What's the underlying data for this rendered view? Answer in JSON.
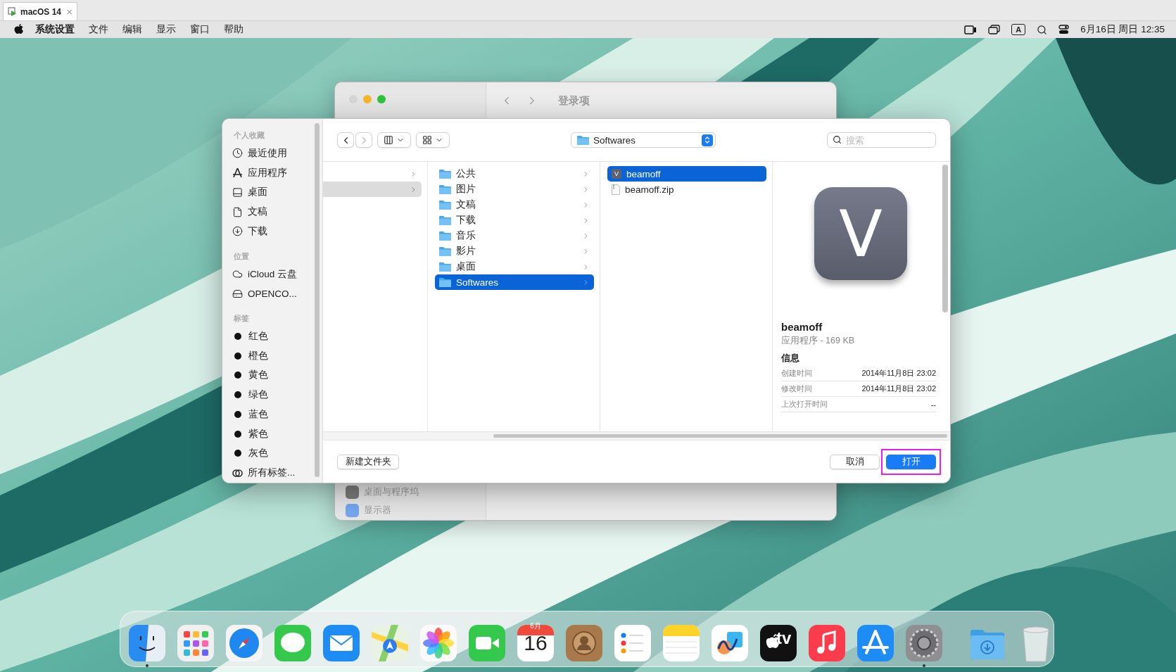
{
  "vm_tab": {
    "title": "macOS 14",
    "close": "×"
  },
  "menu_bar": {
    "app": "系统设置",
    "menus": [
      "文件",
      "编辑",
      "显示",
      "窗口",
      "帮助"
    ],
    "input_indicator": "A",
    "clock": "6月16日 周日 12:35"
  },
  "background_window": {
    "title": "登录项",
    "sidebar_items": [
      "桌面与程序坞",
      "显示器"
    ]
  },
  "dialog": {
    "sidebar": {
      "sections": [
        {
          "heading": "个人收藏",
          "items": [
            {
              "label": "最近使用",
              "kind": "recent"
            },
            {
              "label": "应用程序",
              "kind": "apps"
            },
            {
              "label": "桌面",
              "kind": "desktop"
            },
            {
              "label": "文稿",
              "kind": "documents"
            },
            {
              "label": "下载",
              "kind": "downloads"
            }
          ]
        },
        {
          "heading": "位置",
          "items": [
            {
              "label": "iCloud 云盘",
              "kind": "cloud"
            },
            {
              "label": "OPENCO...",
              "kind": "drive"
            }
          ]
        },
        {
          "heading": "标签",
          "items": [
            {
              "label": "红色",
              "kind": "tag"
            },
            {
              "label": "橙色",
              "kind": "tag"
            },
            {
              "label": "黄色",
              "kind": "tag"
            },
            {
              "label": "绿色",
              "kind": "tag"
            },
            {
              "label": "蓝色",
              "kind": "tag"
            },
            {
              "label": "紫色",
              "kind": "tag"
            },
            {
              "label": "灰色",
              "kind": "tag"
            },
            {
              "label": "所有标签...",
              "kind": "all_tags"
            }
          ]
        }
      ]
    },
    "location": "Softwares",
    "search": {
      "placeholder": "搜索"
    },
    "columns": [
      {
        "items": [
          {
            "selected": false
          },
          {
            "selected": true
          }
        ]
      },
      {
        "items": [
          {
            "label": "公共",
            "selected": false
          },
          {
            "label": "图片",
            "selected": false
          },
          {
            "label": "文稿",
            "selected": false
          },
          {
            "label": "下载",
            "selected": false
          },
          {
            "label": "音乐",
            "selected": false
          },
          {
            "label": "影片",
            "selected": false
          },
          {
            "label": "桌面",
            "selected": false
          },
          {
            "label": "Softwares",
            "selected": true
          }
        ]
      },
      {
        "items": [
          {
            "label": "beamoff",
            "kind": "app",
            "icon_letter": "V",
            "selected": true
          },
          {
            "label": "beamoff.zip",
            "kind": "zip",
            "selected": false
          }
        ]
      }
    ],
    "preview": {
      "icon_letter": "V",
      "name": "beamoff",
      "subtitle": "应用程序 - 169 KB",
      "info_heading": "信息",
      "info": [
        {
          "label": "创建时间",
          "value": "2014年11月8日 23:02"
        },
        {
          "label": "修改时间",
          "value": "2014年11月8日 23:02"
        },
        {
          "label": "上次打开时间",
          "value": "--"
        }
      ]
    },
    "new_folder_button": "新建文件夹",
    "cancel_button": "取消",
    "open_button": {
      "label": "打开",
      "highlighted": true
    }
  },
  "dock": {
    "apps": [
      {
        "kind": "finder",
        "running": true
      },
      {
        "kind": "launchpad",
        "running": false
      },
      {
        "kind": "safari",
        "running": false
      },
      {
        "kind": "messages",
        "running": false
      },
      {
        "kind": "mail",
        "running": false
      },
      {
        "kind": "maps",
        "running": false
      },
      {
        "kind": "photos",
        "running": false
      },
      {
        "kind": "facetime",
        "running": false
      },
      {
        "kind": "calendar",
        "running": false,
        "month": "6月",
        "day": "16"
      },
      {
        "kind": "contacts",
        "running": false
      },
      {
        "kind": "reminders",
        "running": false
      },
      {
        "kind": "notes",
        "running": false
      },
      {
        "kind": "freeform",
        "running": false
      },
      {
        "kind": "tv",
        "running": false,
        "label": "tv"
      },
      {
        "kind": "music",
        "running": false
      },
      {
        "kind": "appstore",
        "running": false
      },
      {
        "kind": "settings",
        "running": true
      }
    ],
    "others": [
      {
        "kind": "downloads"
      },
      {
        "kind": "trash"
      }
    ]
  }
}
